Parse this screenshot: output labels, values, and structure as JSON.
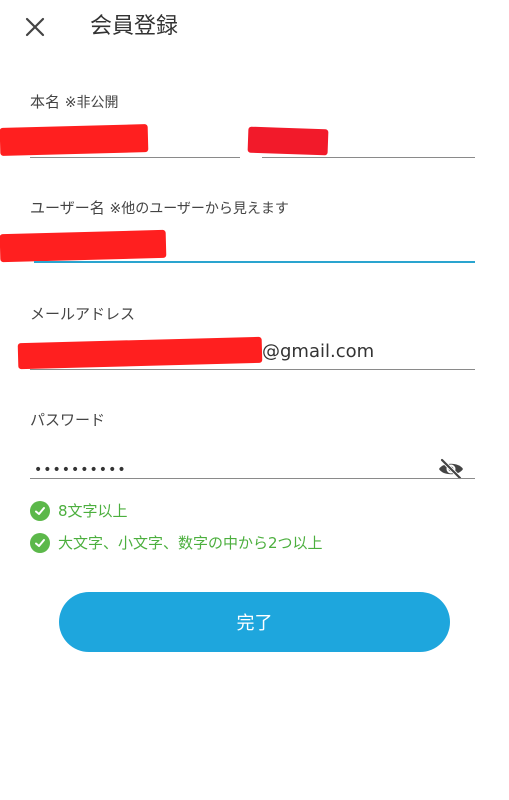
{
  "header": {
    "title": "会員登録"
  },
  "fields": {
    "real_name": {
      "label": "本名",
      "note": "※非公開"
    },
    "username": {
      "label": "ユーザー名",
      "note": "※他のユーザーから見えます"
    },
    "email": {
      "label": "メールアドレス",
      "value_suffix": "@gmail.com"
    },
    "password": {
      "label": "パスワード",
      "value": "••••••••••"
    }
  },
  "rules": [
    {
      "text": "8文字以上"
    },
    {
      "text": "大文字、小文字、数字の中から2つ以上"
    }
  ],
  "submit": {
    "label": "完了"
  },
  "colors": {
    "accent": "#1ea6dd",
    "focus_line": "#2aa4cf",
    "success": "#5cb84a",
    "redaction": "#ff1f1f"
  }
}
